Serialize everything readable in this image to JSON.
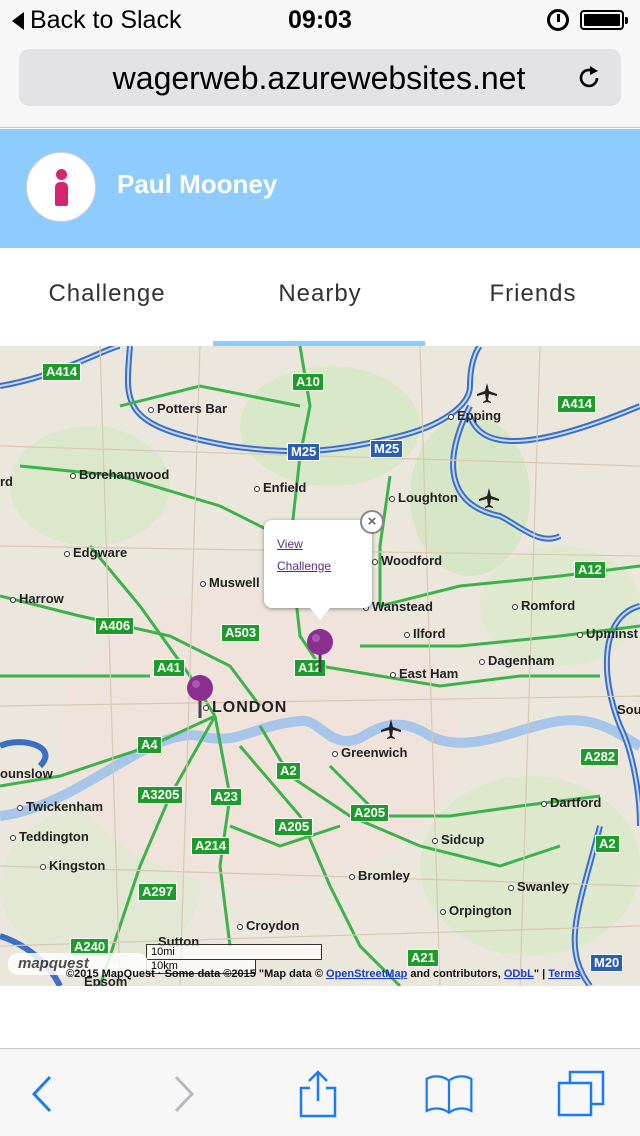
{
  "status_bar": {
    "back_label": "Back to Slack",
    "time": "09:03",
    "icons": [
      "alarm-icon",
      "battery-icon"
    ]
  },
  "browser": {
    "url": "wagerweb.azurewebsites.net",
    "reload_icon": "reload-icon"
  },
  "header": {
    "user_name": "Paul Mooney",
    "avatar_icon": "person-icon",
    "background_color": "#8ecbff",
    "accent_color": "#d6246e"
  },
  "tabs": {
    "items": [
      "Challenge",
      "Nearby",
      "Friends"
    ],
    "active": "Nearby"
  },
  "map": {
    "roads": [
      "A414",
      "A10",
      "A414",
      "M25",
      "M25",
      "A12",
      "A406",
      "A503",
      "A41",
      "A12",
      "A4",
      "A2",
      "A3205",
      "A23",
      "A205",
      "A282",
      "A214",
      "A205",
      "A2",
      "A297",
      "A240",
      "A21",
      "M20"
    ],
    "places": [
      "Potters Bar",
      "Epping",
      "Borehamwood",
      "Enfield",
      "Loughton",
      "Edgware",
      "Muswell",
      "Woodford",
      "Harrow",
      "Wanstead",
      "Romford",
      "Upminst",
      "Ilford",
      "Dagenham",
      "LONDON",
      "East Ham",
      "Greenwich",
      "ounslow",
      "Twickenham",
      "Dartford",
      "Teddington",
      "Sidcup",
      "Kingston",
      "Bromley",
      "Swanley",
      "Orpington",
      "Croydon",
      "Sutton",
      "Epsom",
      "rd",
      "Sou"
    ],
    "popup": {
      "link1": "View",
      "link2": "Challenge",
      "close_label": "×"
    },
    "pins": [
      "pin-central-london",
      "pin-east-london"
    ],
    "scale": {
      "miles": "10mi",
      "km": "10km"
    },
    "attribution": {
      "part1": "©2015 MapQuest · Some data ©2015 \"Map data © ",
      "osm": "OpenStreetMap",
      "part2": " and contributors, ",
      "odbl": "ODbL",
      "sep": "\" | ",
      "terms": "Terms"
    },
    "logo": "mapquest"
  },
  "toolbar": {
    "icons": [
      "back-icon",
      "forward-icon",
      "share-icon",
      "bookmarks-icon",
      "tabs-icon"
    ],
    "tint_color": "#1a7cf5"
  }
}
